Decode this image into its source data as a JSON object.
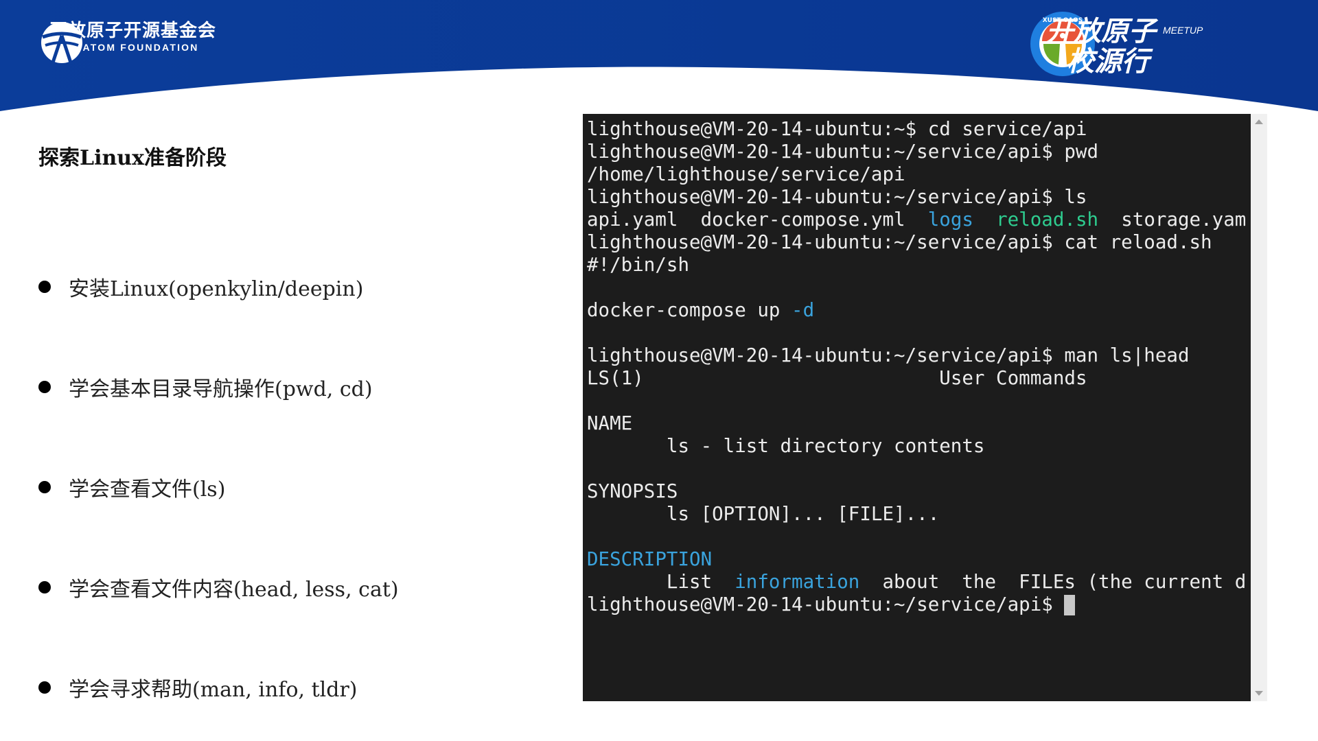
{
  "header": {
    "left_logo": {
      "cn": "开放原子开源基金会",
      "en": "OPENATOM FOUNDATION"
    },
    "right_logo": {
      "badge_text": "XUST OAOS",
      "line1": "开放原子",
      "line2": "校源行",
      "tag": "MEETUP"
    }
  },
  "colors": {
    "brand_blue": "#0a3a96",
    "terminal_bg": "#1c1c1c",
    "dir_blue": "#3aa3dd",
    "exec_green": "#2ecc8f"
  },
  "slide": {
    "title": "探索Linux准备阶段",
    "bullets": [
      "安装Linux(openkylin/deepin)",
      "学会基本目录导航操作(pwd, cd)",
      "学会查看文件(ls)",
      "学会查看文件内容(head, less, cat)",
      "学会寻求帮助(man, info, tldr)"
    ]
  },
  "terminal": {
    "prompt_home": "lighthouse@VM-20-14-ubuntu:~$ ",
    "prompt_api": "lighthouse@VM-20-14-ubuntu:~/service/api$ ",
    "cmd_cd": "cd service/api",
    "cmd_pwd": "pwd",
    "out_pwd": "/home/lighthouse/service/api",
    "cmd_ls": "ls",
    "ls_files": {
      "f1": "api.yaml",
      "f2": "docker-compose.yml",
      "dir": "logs",
      "exec": "reload.sh",
      "f3": "storage.yam"
    },
    "cmd_cat": "cat reload.sh",
    "shebang": "#!/bin/sh",
    "compose_cmd": "docker-compose up ",
    "compose_flag": "-d",
    "cmd_man": "man ls|head",
    "man_header_left": "LS(1)",
    "man_header_center": "User Commands",
    "sec_name": "NAME",
    "name_line": "       ls - list directory contents",
    "sec_synopsis": "SYNOPSIS",
    "synopsis_line": "       ls [OPTION]... [FILE]...",
    "sec_description": "DESCRIPTION",
    "desc_pre": "       List  ",
    "desc_link": "information",
    "desc_post": "  about  the  FILEs (the current d"
  }
}
